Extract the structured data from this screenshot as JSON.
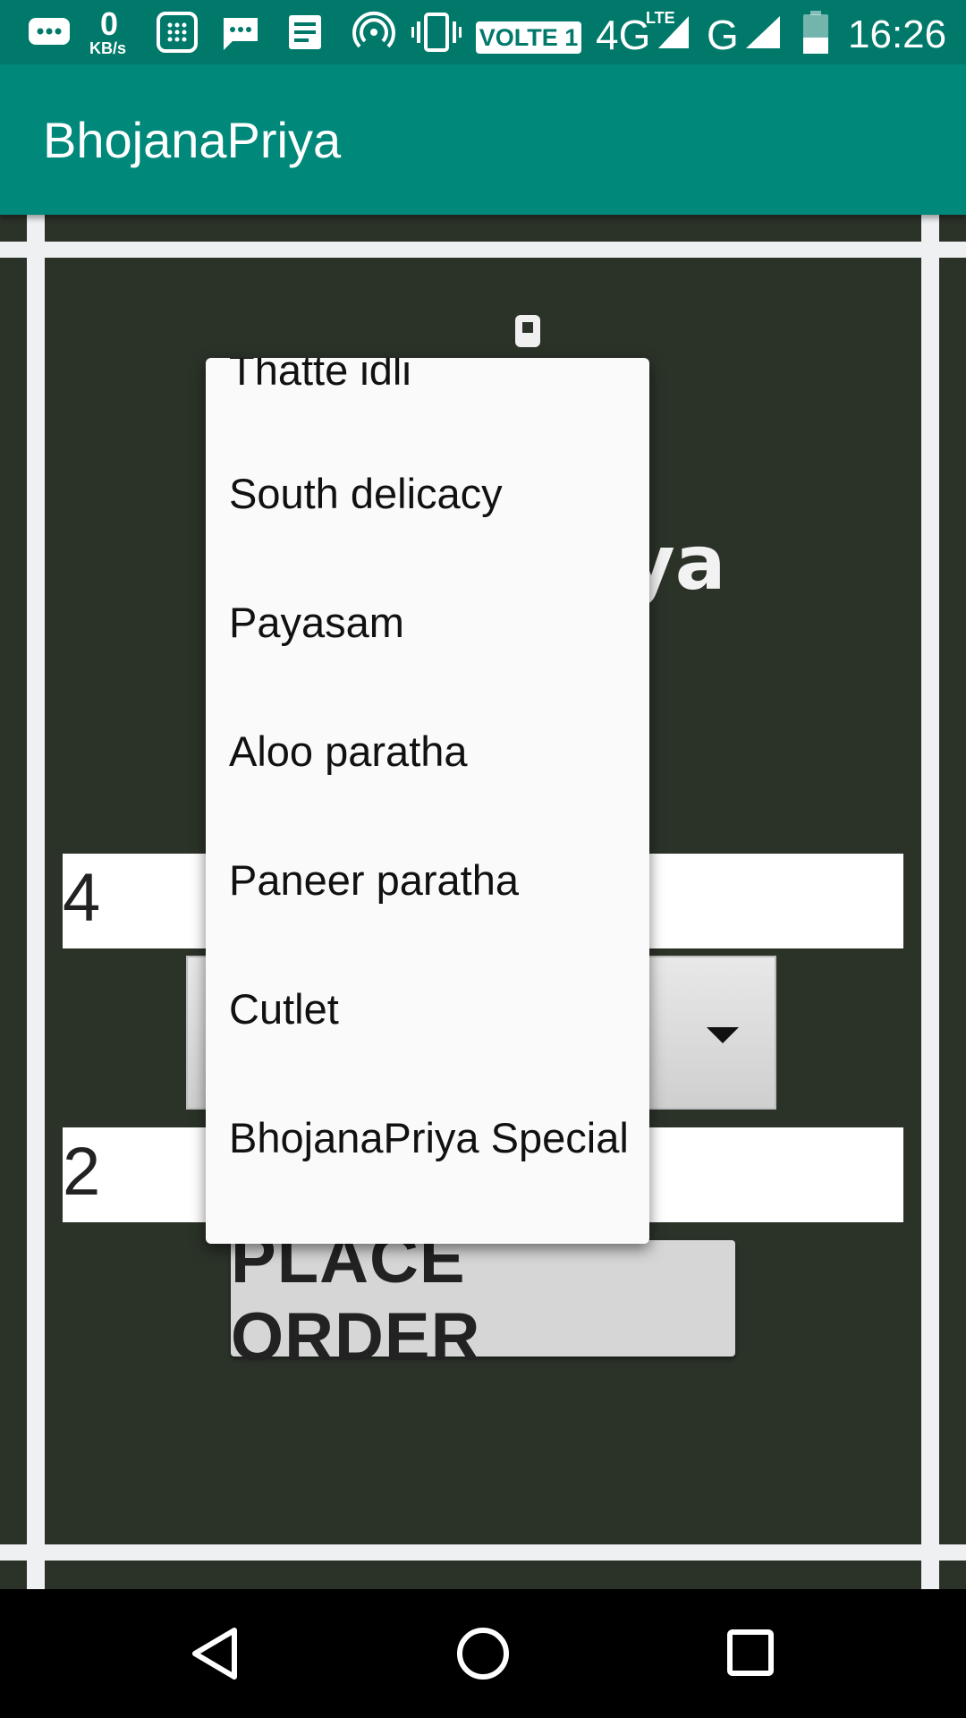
{
  "status_bar": {
    "data_speed_value": "0",
    "data_speed_unit": "KB/s",
    "volte_label": "VOLTE 1",
    "network_4g": "4G",
    "lte_label": "LTE",
    "network_g": "G",
    "time": "16:26",
    "icons": [
      "messaging-icon",
      "calculator-icon",
      "chat-icon",
      "notes-icon",
      "hotspot-icon",
      "vibrate-icon",
      "signal-icon",
      "battery-icon"
    ]
  },
  "app_bar": {
    "title": "BhojanaPriya"
  },
  "form": {
    "quantity_field_value": "4",
    "second_field_value": "2",
    "logo_text_partial": "ya",
    "place_order_label": "PLACE ORDER"
  },
  "dropdown": {
    "items": [
      "Thatte idli",
      "South delicacy",
      "Payasam",
      "Aloo paratha",
      "Paneer paratha",
      "Cutlet",
      "BhojanaPriya Special"
    ]
  },
  "nav_bar": {
    "icons": [
      "back-icon",
      "home-icon",
      "recents-icon"
    ]
  },
  "colors": {
    "status_bar": "#00796b",
    "app_bar": "#00897b",
    "background": "#2b3228"
  }
}
